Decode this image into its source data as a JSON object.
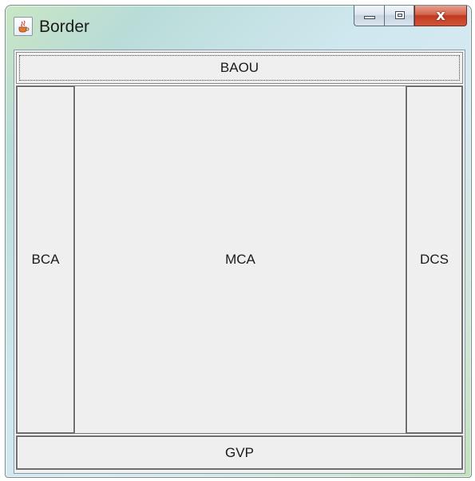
{
  "window": {
    "title": "Border",
    "icon": "java-cup-icon",
    "frame_colors": {
      "aero": "#cfe7ef",
      "close": "#c2391f"
    },
    "caption": {
      "minimize_icon": "minimize-icon",
      "maximize_icon": "maximize-icon",
      "close_glyph": "x"
    }
  },
  "layout": {
    "north": {
      "label": "BAOU"
    },
    "west": {
      "label": "BCA"
    },
    "center": {
      "label": "MCA"
    },
    "east": {
      "label": "DCS"
    },
    "south": {
      "label": "GVP"
    }
  },
  "client_background": "#f0f0f0"
}
